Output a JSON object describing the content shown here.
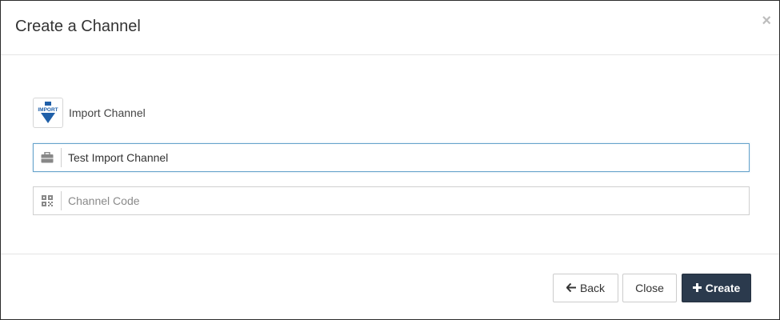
{
  "dialog": {
    "title": "Create a Channel",
    "close_glyph": "×"
  },
  "channel_type": {
    "icon": "import-icon",
    "icon_text": "IMPORT",
    "label": "Import Channel"
  },
  "form": {
    "name": {
      "icon": "briefcase-icon",
      "value": "Test Import Channel",
      "placeholder": ""
    },
    "code": {
      "icon": "qr-code-icon",
      "value": "",
      "placeholder": "Channel Code"
    }
  },
  "footer": {
    "back_label": "Back",
    "back_icon": "arrow-left-icon",
    "close_label": "Close",
    "create_label": "Create",
    "create_icon": "plus-icon"
  },
  "colors": {
    "primary_button": "#2b3a4d",
    "focus_border": "#66a3cc",
    "import_icon_blue": "#1f5fa8"
  }
}
